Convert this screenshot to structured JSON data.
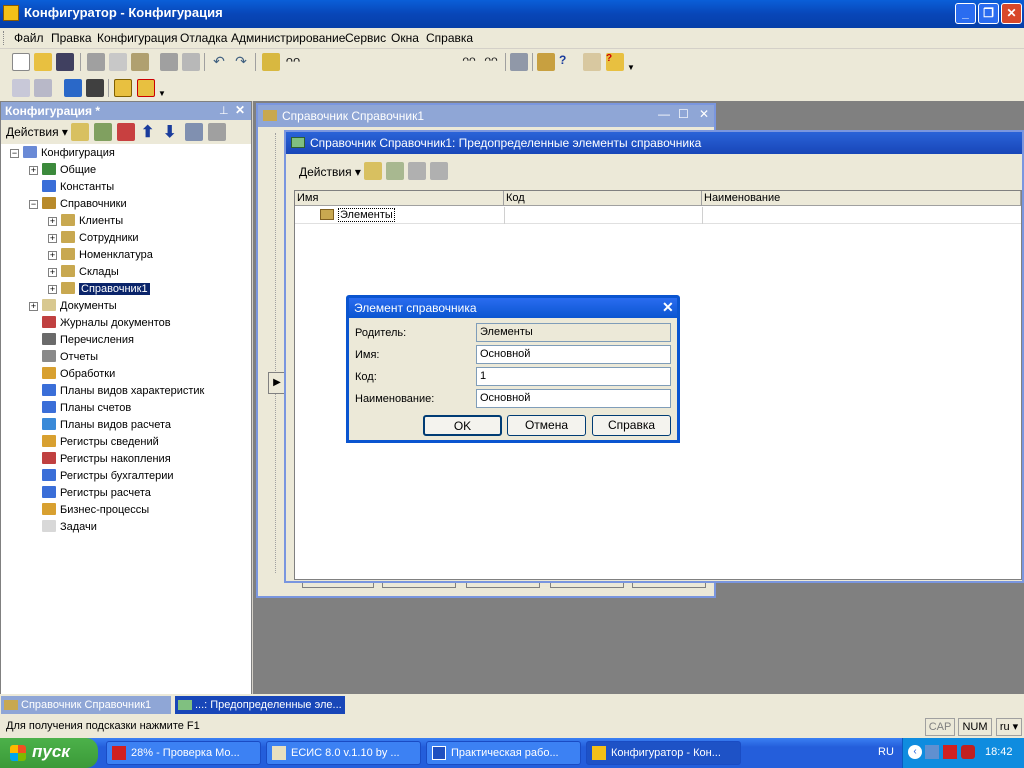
{
  "window": {
    "title": "Конфигуратор - Конфигурация"
  },
  "menu": [
    "Файл",
    "Правка",
    "Конфигурация",
    "Отладка",
    "Администрирование",
    "Сервис",
    "Окна",
    "Справка"
  ],
  "search": {
    "value": ""
  },
  "left_panel": {
    "title": "Конфигурация *",
    "actions_label": "Действия",
    "tree": [
      {
        "label": "Конфигурация",
        "level": 0,
        "expander": "-",
        "icon": "config-icon",
        "color": "#6a8ad6"
      },
      {
        "label": "Общие",
        "level": 1,
        "expander": "+",
        "icon": "common-icon",
        "color": "#3c8a3c"
      },
      {
        "label": "Константы",
        "level": 1,
        "expander": "",
        "icon": "constants-icon",
        "color": "#3a6ed8"
      },
      {
        "label": "Справочники",
        "level": 1,
        "expander": "-",
        "icon": "catalogs-icon",
        "color": "#b88a2a"
      },
      {
        "label": "Клиенты",
        "level": 2,
        "expander": "+",
        "icon": "catalog-icon",
        "color": "#c8a850"
      },
      {
        "label": "Сотрудники",
        "level": 2,
        "expander": "+",
        "icon": "catalog-icon",
        "color": "#c8a850"
      },
      {
        "label": "Номенклатура",
        "level": 2,
        "expander": "+",
        "icon": "catalog-icon",
        "color": "#c8a850"
      },
      {
        "label": "Склады",
        "level": 2,
        "expander": "+",
        "icon": "catalog-icon",
        "color": "#c8a850"
      },
      {
        "label": "Справочник1",
        "level": 2,
        "expander": "+",
        "icon": "catalog-icon",
        "color": "#c8a850",
        "selected": true
      },
      {
        "label": "Документы",
        "level": 1,
        "expander": "+",
        "icon": "documents-icon",
        "color": "#d8c890"
      },
      {
        "label": "Журналы документов",
        "level": 1,
        "expander": "",
        "icon": "journals-icon",
        "color": "#c04040"
      },
      {
        "label": "Перечисления",
        "level": 1,
        "expander": "",
        "icon": "enums-icon",
        "color": "#6a6a6a"
      },
      {
        "label": "Отчеты",
        "level": 1,
        "expander": "",
        "icon": "reports-icon",
        "color": "#8a8a8a"
      },
      {
        "label": "Обработки",
        "level": 1,
        "expander": "",
        "icon": "processing-icon",
        "color": "#d8a030"
      },
      {
        "label": "Планы видов характеристик",
        "level": 1,
        "expander": "",
        "icon": "charts-icon",
        "color": "#3a6ed8"
      },
      {
        "label": "Планы счетов",
        "level": 1,
        "expander": "",
        "icon": "accounts-icon",
        "color": "#3a6ed8"
      },
      {
        "label": "Планы видов расчета",
        "level": 1,
        "expander": "",
        "icon": "calc-types-icon",
        "color": "#3a8ad8"
      },
      {
        "label": "Регистры сведений",
        "level": 1,
        "expander": "",
        "icon": "info-registers-icon",
        "color": "#d8a030"
      },
      {
        "label": "Регистры накопления",
        "level": 1,
        "expander": "",
        "icon": "accum-registers-icon",
        "color": "#c04040"
      },
      {
        "label": "Регистры бухгалтерии",
        "level": 1,
        "expander": "",
        "icon": "acct-registers-icon",
        "color": "#3a6ed8"
      },
      {
        "label": "Регистры расчета",
        "level": 1,
        "expander": "",
        "icon": "calc-registers-icon",
        "color": "#3a6ed8"
      },
      {
        "label": "Бизнес-процессы",
        "level": 1,
        "expander": "",
        "icon": "business-icon",
        "color": "#d8a030"
      },
      {
        "label": "Задачи",
        "level": 1,
        "expander": "",
        "icon": "tasks-icon",
        "color": "#d8d8d8"
      }
    ]
  },
  "win1": {
    "title": "Справочник Справочник1"
  },
  "win2": {
    "title": "Справочник Справочник1: Предопределенные элементы справочника",
    "actions_label": "Действия",
    "columns": [
      "Имя",
      "Код",
      "Наименование"
    ],
    "rows": [
      {
        "name": "Элементы",
        "code": "",
        "description": ""
      }
    ]
  },
  "dialog": {
    "title": "Элемент справочника",
    "fields": [
      {
        "label": "Родитель:",
        "value": "Элементы",
        "readonly": true
      },
      {
        "label": "Имя:",
        "value": "Основной",
        "readonly": false
      },
      {
        "label": "Код:",
        "value": "1",
        "readonly": false
      },
      {
        "label": "Наименование:",
        "value": "Основной",
        "readonly": false
      }
    ],
    "ok": "OK",
    "cancel": "Отмена",
    "help": "Справка"
  },
  "mdi_tabs": [
    "Справочник Справочник1",
    "...: Предопределенные эле..."
  ],
  "status": {
    "hint": "Для получения подсказки нажмите F1",
    "cap": "CAP",
    "num": "NUM",
    "lang": "ru"
  },
  "taskbar": {
    "start": "пуск",
    "tasks": [
      "28% - Проверка Мо...",
      "ЕСИС 8.0 v.1.10 by ...",
      "Практическая рабо...",
      "Конфигуратор - Кон..."
    ],
    "lang": "RU",
    "time": "18:42"
  }
}
